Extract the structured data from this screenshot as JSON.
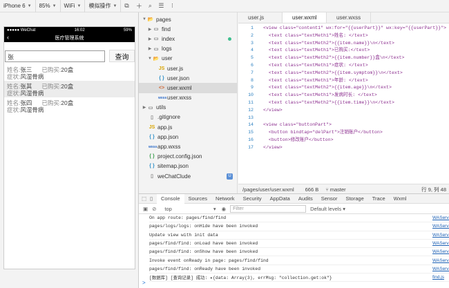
{
  "toolbar": {
    "device": "iPhone 6",
    "zoom": "85%",
    "network": "WiFi",
    "simulate_action": "模拟操作"
  },
  "phone": {
    "status_carrier": "●●●●● WeChat",
    "status_time": "16:02",
    "status_battery": "59%",
    "nav_title": "医疗管理系统",
    "search_value": "张",
    "search_button": "查询",
    "records": [
      {
        "name_label": "姓名:",
        "name": "张三",
        "bought_label": "已购买:",
        "bought": "20盒",
        "symptom_label": "症状:",
        "symptom": "风湿骨病"
      },
      {
        "name_label": "姓名:",
        "name": "张其",
        "bought_label": "已购买:",
        "bought": "20盒",
        "symptom_label": "症状:",
        "symptom": "风湿骨病"
      },
      {
        "name_label": "姓名:",
        "name": "张四",
        "bought_label": "已购买:",
        "bought": "20盒",
        "symptom_label": "症状:",
        "symptom": "风湿骨病"
      }
    ]
  },
  "explorer": {
    "nodes": [
      {
        "label": "pages"
      },
      {
        "label": "find"
      },
      {
        "label": "index"
      },
      {
        "label": "logs"
      },
      {
        "label": "user"
      },
      {
        "label": "user.js",
        "icon": "JS"
      },
      {
        "label": "user.json",
        "icon": "{ }"
      },
      {
        "label": "user.wxml",
        "icon": "<>"
      },
      {
        "label": "user.wxss",
        "icon": "wxss"
      },
      {
        "label": "utils"
      },
      {
        "label": ".gitignore"
      },
      {
        "label": "app.js",
        "icon": "JS"
      },
      {
        "label": "app.json",
        "icon": "{ }"
      },
      {
        "label": "app.wxss",
        "icon": "wxss"
      },
      {
        "label": "project.config.json",
        "icon": "{ }"
      },
      {
        "label": "sitemap.json",
        "icon": "{ }"
      },
      {
        "label": "weChatClude",
        "badge": "U"
      }
    ]
  },
  "editor": {
    "tabs": [
      "user.js",
      "user.wxml",
      "user.wxss"
    ],
    "lines": [
      {
        "n": "1",
        "t": "<view class=\"content1\" wx:for=\"{{userPart}}\" wx:key=\"{{userPart}}\">"
      },
      {
        "n": "2",
        "t": "  <text class=\"textMeth1\">姓名: </text>"
      },
      {
        "n": "3",
        "t": "  <text class=\"textMeth2\">{{item.name}}\\n</text>"
      },
      {
        "n": "4",
        "t": "  <text class=\"textMeth1\">已购买:</text>"
      },
      {
        "n": "5",
        "t": "  <text class=\"textMeth2\">{{item.number}}盒\\n</text>"
      },
      {
        "n": "6",
        "t": "  <text class=\"textMeth1\">症状: </text>"
      },
      {
        "n": "7",
        "t": "  <text class=\"textMeth2\">{{item.symptom}}\\n</text>"
      },
      {
        "n": "8",
        "t": "  <text class=\"textMeth1\">年龄: </text>"
      },
      {
        "n": "9",
        "t": "  <text class=\"textMeth2\">{{item.age}}\\n</text>"
      },
      {
        "n": "10",
        "t": "  <text class=\"textMeth1\">发病时长: </text>"
      },
      {
        "n": "11",
        "t": "  <text class=\"textMeth2\">{{item.time}}\\n</text>"
      },
      {
        "n": "12",
        "t": "</view>"
      },
      {
        "n": "13",
        "t": ""
      },
      {
        "n": "14",
        "t": "<view class=\"buttonPart\">"
      },
      {
        "n": "15",
        "t": "  <button bindtap=\"delPart\">注销账户</button>"
      },
      {
        "n": "16",
        "t": "  <button>修改账户</button>"
      },
      {
        "n": "17",
        "t": "</view>"
      }
    ],
    "status_path": "/pages/user/user.wxml",
    "status_size": "666 B",
    "status_branch": "master",
    "status_pos": "行 9, 列 48"
  },
  "console": {
    "tabs": [
      "Console",
      "Sources",
      "Network",
      "Security",
      "AppData",
      "Audits",
      "Sensor",
      "Storage",
      "Trace",
      "Wxml"
    ],
    "context": "top",
    "filter_placeholder": "Filter",
    "levels": "Default levels ▾",
    "logs": [
      {
        "text": "On app route: pages/find/find",
        "src": "WAService.js"
      },
      {
        "text": "pages/logs/logs: onHide have been invoked",
        "src": "WAService.js"
      },
      {
        "text": "Update view with init data",
        "src": "WAService.js"
      },
      {
        "text": "pages/find/find: onLoad have been invoked",
        "src": "WAService.js"
      },
      {
        "text": "pages/find/find: onShow have been invoked",
        "src": "WAService.js"
      },
      {
        "text": "Invoke event onReady in page: pages/find/find",
        "src": "WAService.js"
      },
      {
        "text": "pages/find/find: onReady have been invoked",
        "src": "WAService.js"
      },
      {
        "text": "[数据库] [查询记录] 成功: ▸{data: Array(3), errMsg: \"collection.get:ok\"}",
        "src": "find.js"
      }
    ],
    "prompt": ">"
  }
}
